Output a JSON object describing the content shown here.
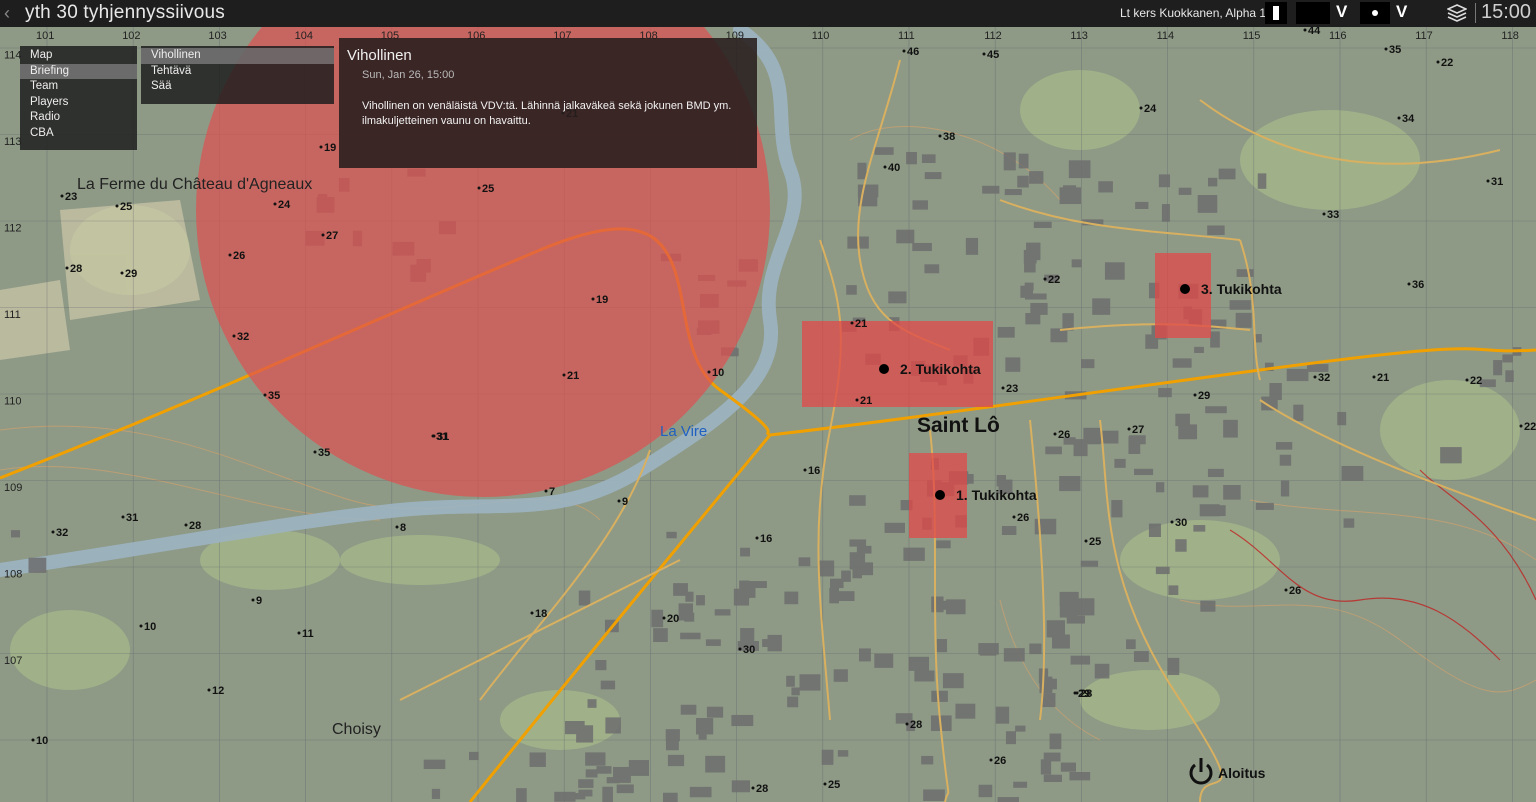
{
  "topbar": {
    "back_icon": "chevron-left-icon",
    "mission_title": "yth 30 tyhjennyssiivous",
    "player_info": "Lt kers Kuokkanen, Alpha 1-2 1",
    "time": "15:00",
    "layers_icon": "layers-icon"
  },
  "menu": {
    "items": [
      "Map",
      "Briefing",
      "Team",
      "Players",
      "Radio",
      "CBA"
    ],
    "selected": "Briefing"
  },
  "submenu": {
    "items": [
      "Vihollinen",
      "Tehtävä",
      "Sää"
    ],
    "selected": "Vihollinen"
  },
  "briefing_panel": {
    "title": "Vihollinen",
    "date": "Sun, Jan 26,  15:00",
    "body": "Vihollinen on venäläistä VDV:tä. Lähinnä jalkaväkeä sekä jokunen BMD ym. ilmakuljetteinen vaunu on havaittu."
  },
  "map": {
    "grid_top_labels": [
      "101",
      "102",
      "103",
      "104",
      "105",
      "106",
      "107",
      "108",
      "109",
      "110",
      "111",
      "112",
      "113",
      "114",
      "115",
      "116",
      "117",
      "118"
    ],
    "grid_left_labels": [
      "114",
      "113",
      "112",
      "111",
      "110",
      "109",
      "108",
      "107"
    ],
    "places": [
      {
        "name": "La Ferme du Château d'Agneaux"
      },
      {
        "name": "Saint Lô"
      },
      {
        "name": "La Vire"
      },
      {
        "name": "Choisy"
      }
    ],
    "markers": [
      {
        "label": "1. Tukikohta"
      },
      {
        "label": "2. Tukikohta"
      },
      {
        "label": "3. Tukikohta"
      }
    ],
    "start_marker": {
      "label": "Aloitus",
      "icon": "power-icon"
    },
    "elevations": [
      "23",
      "25",
      "28",
      "29",
      "24",
      "27",
      "26",
      "32",
      "35",
      "35",
      "31",
      "32",
      "31",
      "28",
      "8",
      "9",
      "7",
      "10",
      "19",
      "21",
      "25",
      "19",
      "21",
      "31",
      "9",
      "10",
      "11",
      "12",
      "10",
      "16",
      "16",
      "18",
      "20",
      "30",
      "29",
      "26",
      "28",
      "28",
      "25",
      "22",
      "21",
      "23",
      "21",
      "26",
      "27",
      "29",
      "24",
      "38",
      "40",
      "46",
      "45",
      "44",
      "35",
      "22",
      "34",
      "31",
      "33",
      "36",
      "32",
      "21",
      "22",
      "22",
      "26",
      "30",
      "25",
      "26",
      "28"
    ],
    "colors": {
      "threat_zone": "#e05050",
      "base_zone": "#e04848",
      "road_main": "#f0a000",
      "road": "#d8b060",
      "river": "#9cb4c2",
      "contour": "#c8a070",
      "river_label": "#2060c0"
    }
  }
}
